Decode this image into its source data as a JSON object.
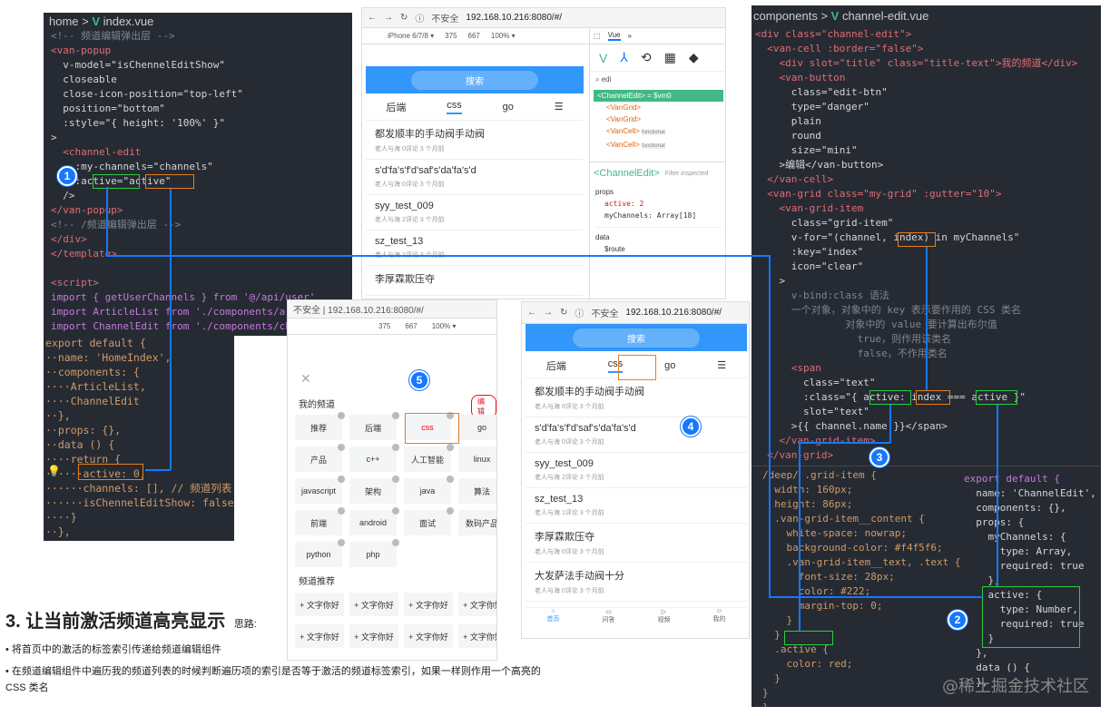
{
  "left_editor": {
    "breadcrumb": {
      "home": "home",
      "sep": ">",
      "vue_icon": "V",
      "file": "index.vue"
    },
    "template_lines": [
      "<!-- 频道编辑弹出层 -->",
      "<van-popup",
      "  v-model=\"isChennelEditShow\"",
      "  closeable",
      "  close-icon-position=\"top-left\"",
      "  position=\"bottom\"",
      "  :style=\"{ height: '100%' }\"",
      ">",
      "  <channel-edit",
      "    :my-channels=\"channels\"",
      "    :active=\"active\"",
      "  />",
      "</van-popup>",
      "<!-- /频道编辑弹出层 -->",
      "</div>",
      "</template>",
      "",
      "<script>",
      "import { getUserChannels } from '@/api/user'",
      "import ArticleList from './components/article-list'",
      "import ChannelEdit from './components/channel-edit'"
    ],
    "script_lines": [
      "export default {",
      "··name: 'HomeIndex',",
      "··components: {",
      "····ArticleList,",
      "····ChannelEdit",
      "··},",
      "··props: {},",
      "··data () {",
      "····return {",
      "······active: 0,",
      "······channels: [], // 频道列表",
      "······isChennelEditShow: false",
      "····}",
      "··},"
    ]
  },
  "right_editor": {
    "breadcrumb": {
      "folder": "components",
      "sep": ">",
      "vue_icon": "V",
      "file": "channel-edit.vue"
    },
    "template_lines": [
      "<div class=\"channel-edit\">",
      "  <van-cell :border=\"false\">",
      "    <div slot=\"title\" class=\"title-text\">我的频道</div>",
      "    <van-button",
      "      class=\"edit-btn\"",
      "      type=\"danger\"",
      "      plain",
      "      round",
      "      size=\"mini\"",
      "    >编辑</van-button>",
      "  </van-cell>",
      "  <van-grid class=\"my-grid\" :gutter=\"10\">",
      "    <van-grid-item",
      "      class=\"grid-item\"",
      "      v-for=\"(channel, index) in myChannels\"",
      "      :key=\"index\"",
      "      icon=\"clear\"",
      "    >",
      "      v-bind:class 语法",
      "      一个对象，对象中的 key 表示要作用的 CSS 类名",
      "               对象中的 value 要计算出布尔值",
      "                 true，则作用该类名",
      "                 false，不作用类名",
      "      <span",
      "        class=\"text\"",
      "        :class=\"{ active: index === active }\"",
      "        slot=\"text\"",
      "      >{{ channel.name }}</span>",
      "    </van-grid-item>",
      "  </van-grid>"
    ],
    "css_lines": [
      "/deep/ .grid-item {",
      "  width: 160px;",
      "  height: 86px;",
      "  .van-grid-item__content {",
      "    white-space: nowrap;",
      "    background-color: #f4f5f6;",
      "    .van-grid-item__text, .text {",
      "      font-size: 28px;",
      "      color: #222;",
      "      margin-top: 0;",
      "    }",
      "  }",
      "  .active {",
      "    color: red;",
      "  }",
      "}",
      "}"
    ],
    "js_lines": [
      "export default {",
      "  name: 'ChannelEdit',",
      "  components: {},",
      "  props: {",
      "    myChannels: {",
      "      type: Array,",
      "      required: true",
      "    },",
      "    active: {",
      "      type: Number,",
      "      required: true",
      "    }",
      "  },",
      "  data () {",
      "  },"
    ]
  },
  "devtools_browser": {
    "security": "不安全",
    "url": "192.168.10.216:8080/#/",
    "device": "iPhone 6/7/8 ▾",
    "width": "375",
    "height": "667",
    "zoom": "100% ▾",
    "search_label": "搜索",
    "tabs": [
      "后端",
      "css",
      "go"
    ],
    "articles": [
      {
        "title": "都发顺丰的手动阀手动阀",
        "meta": "老人与海  0评论  3 个月前"
      },
      {
        "title": "s'd'fa's'f'd'saf's'da'fa's'd",
        "meta": "老人与海  0评论  3 个月前"
      },
      {
        "title": "syy_test_009",
        "meta": "老人与海  2评论  3 个月前"
      },
      {
        "title": "sz_test_13",
        "meta": "老人与海  1评论  3 个月前"
      },
      {
        "title": "李厚霖欺压夺",
        "meta": ""
      }
    ],
    "vue_panel": {
      "tab": "Vue",
      "filter": "edi",
      "tree": [
        "<ChannelEdit> = $vm0",
        "<VanGrid>",
        "<VanGrid>",
        "<VanCell>",
        "<VanCell>"
      ],
      "functional": "functional",
      "selected": "<ChannelEdit>",
      "filter_placeholder": "Filter inspected",
      "props_label": "props",
      "prop_active": "active: 2",
      "prop_channels": "myChannels: Array[18]",
      "data_label": "data",
      "route": "$route"
    }
  },
  "popup_browser": {
    "url": "不安全 | 192.168.10.216:8080/#/",
    "width": "375",
    "height": "667",
    "zoom": "100% ▾",
    "close": "✕",
    "my_channels_title": "我的频道",
    "edit_button": "编辑",
    "channels": [
      "推荐",
      "后端",
      "css",
      "go",
      "产品",
      "c++",
      "人工智能",
      "linux",
      "javascript",
      "架构",
      "java",
      "算法",
      "前端",
      "android",
      "面试",
      "数码产品",
      "python",
      "php"
    ],
    "recommend_title": "频道推荐",
    "recommend": [
      "+ 文字你好",
      "+ 文字你好",
      "+ 文字你好",
      "+ 文字你好",
      "+ 文字你好",
      "+ 文字你好",
      "+ 文字你好",
      "+ 文字你好"
    ]
  },
  "home_browser": {
    "security": "不安全",
    "url": "192.168.10.216:8080/#/",
    "search_label": "搜索",
    "tabs": [
      "后端",
      "css",
      "go"
    ],
    "articles": [
      {
        "title": "都发顺丰的手动阀手动阀",
        "meta": "老人与海  0评论  3 个月前"
      },
      {
        "title": "s'd'fa's'f'd'saf's'da'fa's'd",
        "meta": "老人与海  0评论  3 个月前"
      },
      {
        "title": "syy_test_009",
        "meta": "老人与海  2评论  3 个月前"
      },
      {
        "title": "sz_test_13",
        "meta": "老人与海  1评论  3 个月前"
      },
      {
        "title": "李厚霖欺压夺",
        "meta": "老人与海  0评论  3 个月前"
      },
      {
        "title": "大发萨法手动阀十分",
        "meta": "老人与海  0评论  3 个月前"
      }
    ],
    "tabbar": [
      "首页",
      "问答",
      "视频",
      "我的"
    ]
  },
  "badges": [
    "1",
    "2",
    "3",
    "4",
    "5"
  ],
  "notes": {
    "heading": "3. 让当前激活频道高亮显示",
    "heading_suffix": "思路:",
    "bullet1": "将首页中的激活的标签索引传递给频道编辑组件",
    "bullet2": "在频道编辑组件中遍历我的频道列表的时候判断遍历项的索引是否等于激活的频道标签索引，如果一样则作用一个高亮的 CSS 类名"
  },
  "watermark": "@稀土掘金技术社区",
  "colors": {
    "editor_bg": "#262b33",
    "accent": "#1677ff",
    "green_box": "#2ecc40",
    "orange_box": "#e67e22",
    "app_blue": "#3296fa"
  }
}
